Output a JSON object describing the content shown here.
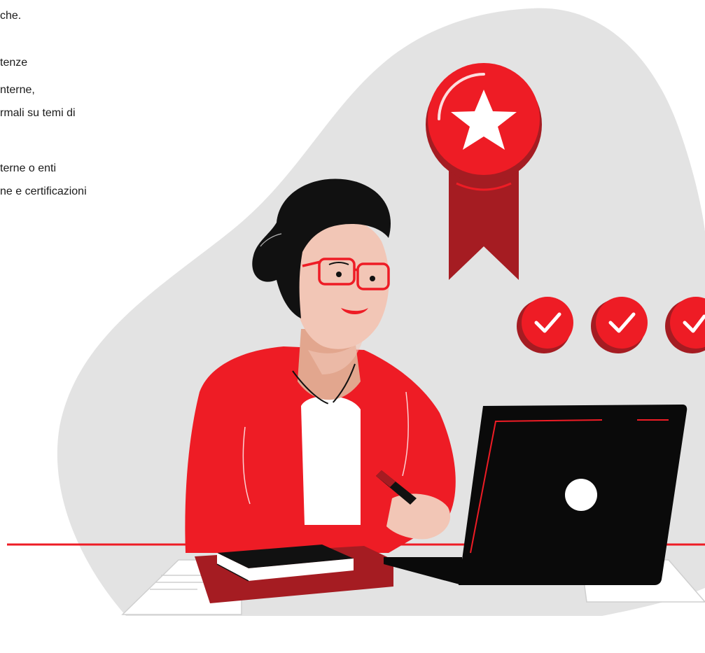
{
  "text_fragments": [
    "che.",
    "tenze",
    "nterne,",
    "rmali su temi di",
    "terne o enti",
    "ne e certificazioni"
  ],
  "colors": {
    "accent_red": "#EE1C25",
    "dark_red": "#A51C22",
    "background_blob": "#E3E3E3",
    "laptop": "#0A0A0A",
    "skin": "#F2C6B6",
    "hair": "#111111"
  },
  "icons": [
    "award-ribbon-icon",
    "star-icon",
    "check-icon",
    "laptop-logo-icon"
  ]
}
